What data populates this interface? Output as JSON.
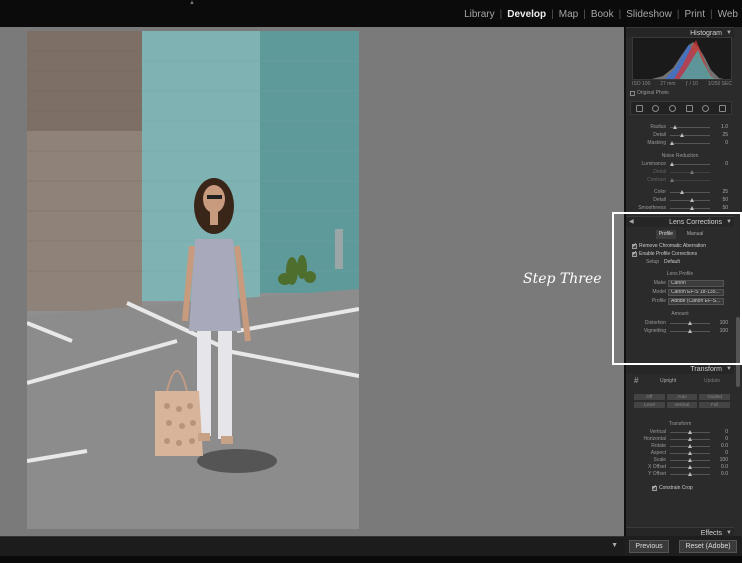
{
  "modules": [
    "Library",
    "Develop",
    "Map",
    "Book",
    "Slideshow",
    "Print",
    "Web"
  ],
  "active_module": "Develop",
  "annotation": {
    "text": "Step Three"
  },
  "histogram": {
    "header": "Histogram",
    "info": [
      "ISO 100",
      "27 mm",
      "ƒ / 10",
      "1/250 SEC"
    ],
    "original_photo_label": "Original Photo"
  },
  "detail": {
    "rows": [
      {
        "label": "Radius",
        "value": "1.0"
      },
      {
        "label": "Detail",
        "value": "25"
      },
      {
        "label": "Masking",
        "value": "0"
      }
    ],
    "noise_title": "Noise Reduction",
    "noise_rows": [
      {
        "label": "Luminance",
        "value": "0"
      },
      {
        "label": "Detail",
        "value": ""
      },
      {
        "label": "Contrast",
        "value": ""
      }
    ],
    "color_rows": [
      {
        "label": "Color",
        "value": "25"
      },
      {
        "label": "Detail",
        "value": "50"
      },
      {
        "label": "Smoothness",
        "value": "50"
      }
    ]
  },
  "lens": {
    "header": "Lens Corrections",
    "tabs": [
      "Profile",
      "Manual"
    ],
    "active_tab": "Profile",
    "checks": [
      "Remove Chromatic Aberration",
      "Enable Profile Corrections"
    ],
    "setup_label": "Setup",
    "setup_value": "Default",
    "lens_profile_title": "Lens Profile",
    "profile_rows": [
      {
        "label": "Make",
        "value": "Canon"
      },
      {
        "label": "Model",
        "value": "Canon EF-S 18-135..."
      },
      {
        "label": "Profile",
        "value": "Adobe (Canon EF-S..."
      }
    ],
    "amount_title": "Amount",
    "amount_rows": [
      {
        "label": "Distortion",
        "value": "100"
      },
      {
        "label": "Vignetting",
        "value": "100"
      }
    ]
  },
  "transform": {
    "header": "Transform",
    "upright_label": "Upright",
    "update_label": "Update",
    "upright_buttons": [
      "Off",
      "Auto",
      "Guided",
      "Level",
      "Vertical",
      "Full"
    ],
    "title": "Transform",
    "rows": [
      {
        "label": "Vertical",
        "value": "0"
      },
      {
        "label": "Horizontal",
        "value": "0"
      },
      {
        "label": "Rotate",
        "value": "0.0"
      },
      {
        "label": "Aspect",
        "value": "0"
      },
      {
        "label": "Scale",
        "value": "100"
      },
      {
        "label": "X Offset",
        "value": "0.0"
      },
      {
        "label": "Y Offset",
        "value": "0.0"
      }
    ],
    "constrain_label": "Constrain Crop"
  },
  "effects_header": "Effects",
  "footer": {
    "previous": "Previous",
    "reset": "Reset (Adobe)"
  }
}
